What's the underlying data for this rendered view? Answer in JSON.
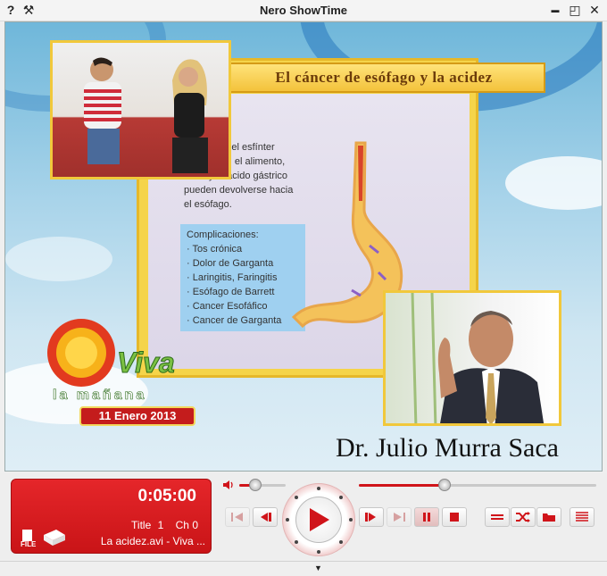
{
  "window": {
    "title": "Nero ShowTime",
    "left_icons": [
      "help-icon",
      "settings-tool-icon"
    ],
    "right_icons": [
      "minimize-icon",
      "restore-icon",
      "close-icon"
    ],
    "help_glyph": "?",
    "tool_glyph": "⚒",
    "min_glyph": "▬",
    "restore_glyph": "◰",
    "close_glyph": "✕"
  },
  "video": {
    "board_title": "El cáncer de esófago y la acidez",
    "board_text_lines": [
      "culo del esfínter",
      "bien, el alimento,",
      "y el ácido gástrico",
      "pueden devolverse hacia",
      "el esófago."
    ],
    "complications_title": "Complicaciones:",
    "complications": [
      "· Tos crónica",
      "· Dolor de Garganta",
      "· Laringitis, Faringitis",
      "· Esófago de Barrett",
      "· Cancer Esofáfico",
      "· Cancer de Garganta"
    ],
    "logo_text": "Viva",
    "logo_subtext": "la mañana",
    "date": "11 Enero 2013",
    "caption": "Dr. Julio Murra Saca"
  },
  "lcd": {
    "time": "0:05:00",
    "title_label": "Title",
    "title_num": "1",
    "chapter": "Ch 0",
    "file": "La acidez.avi - Viva ...",
    "file_icon_label": "FILE"
  },
  "controls": {
    "volume_level": 0.35,
    "seek_position": 0.36,
    "accent_color": "#d0141a"
  }
}
